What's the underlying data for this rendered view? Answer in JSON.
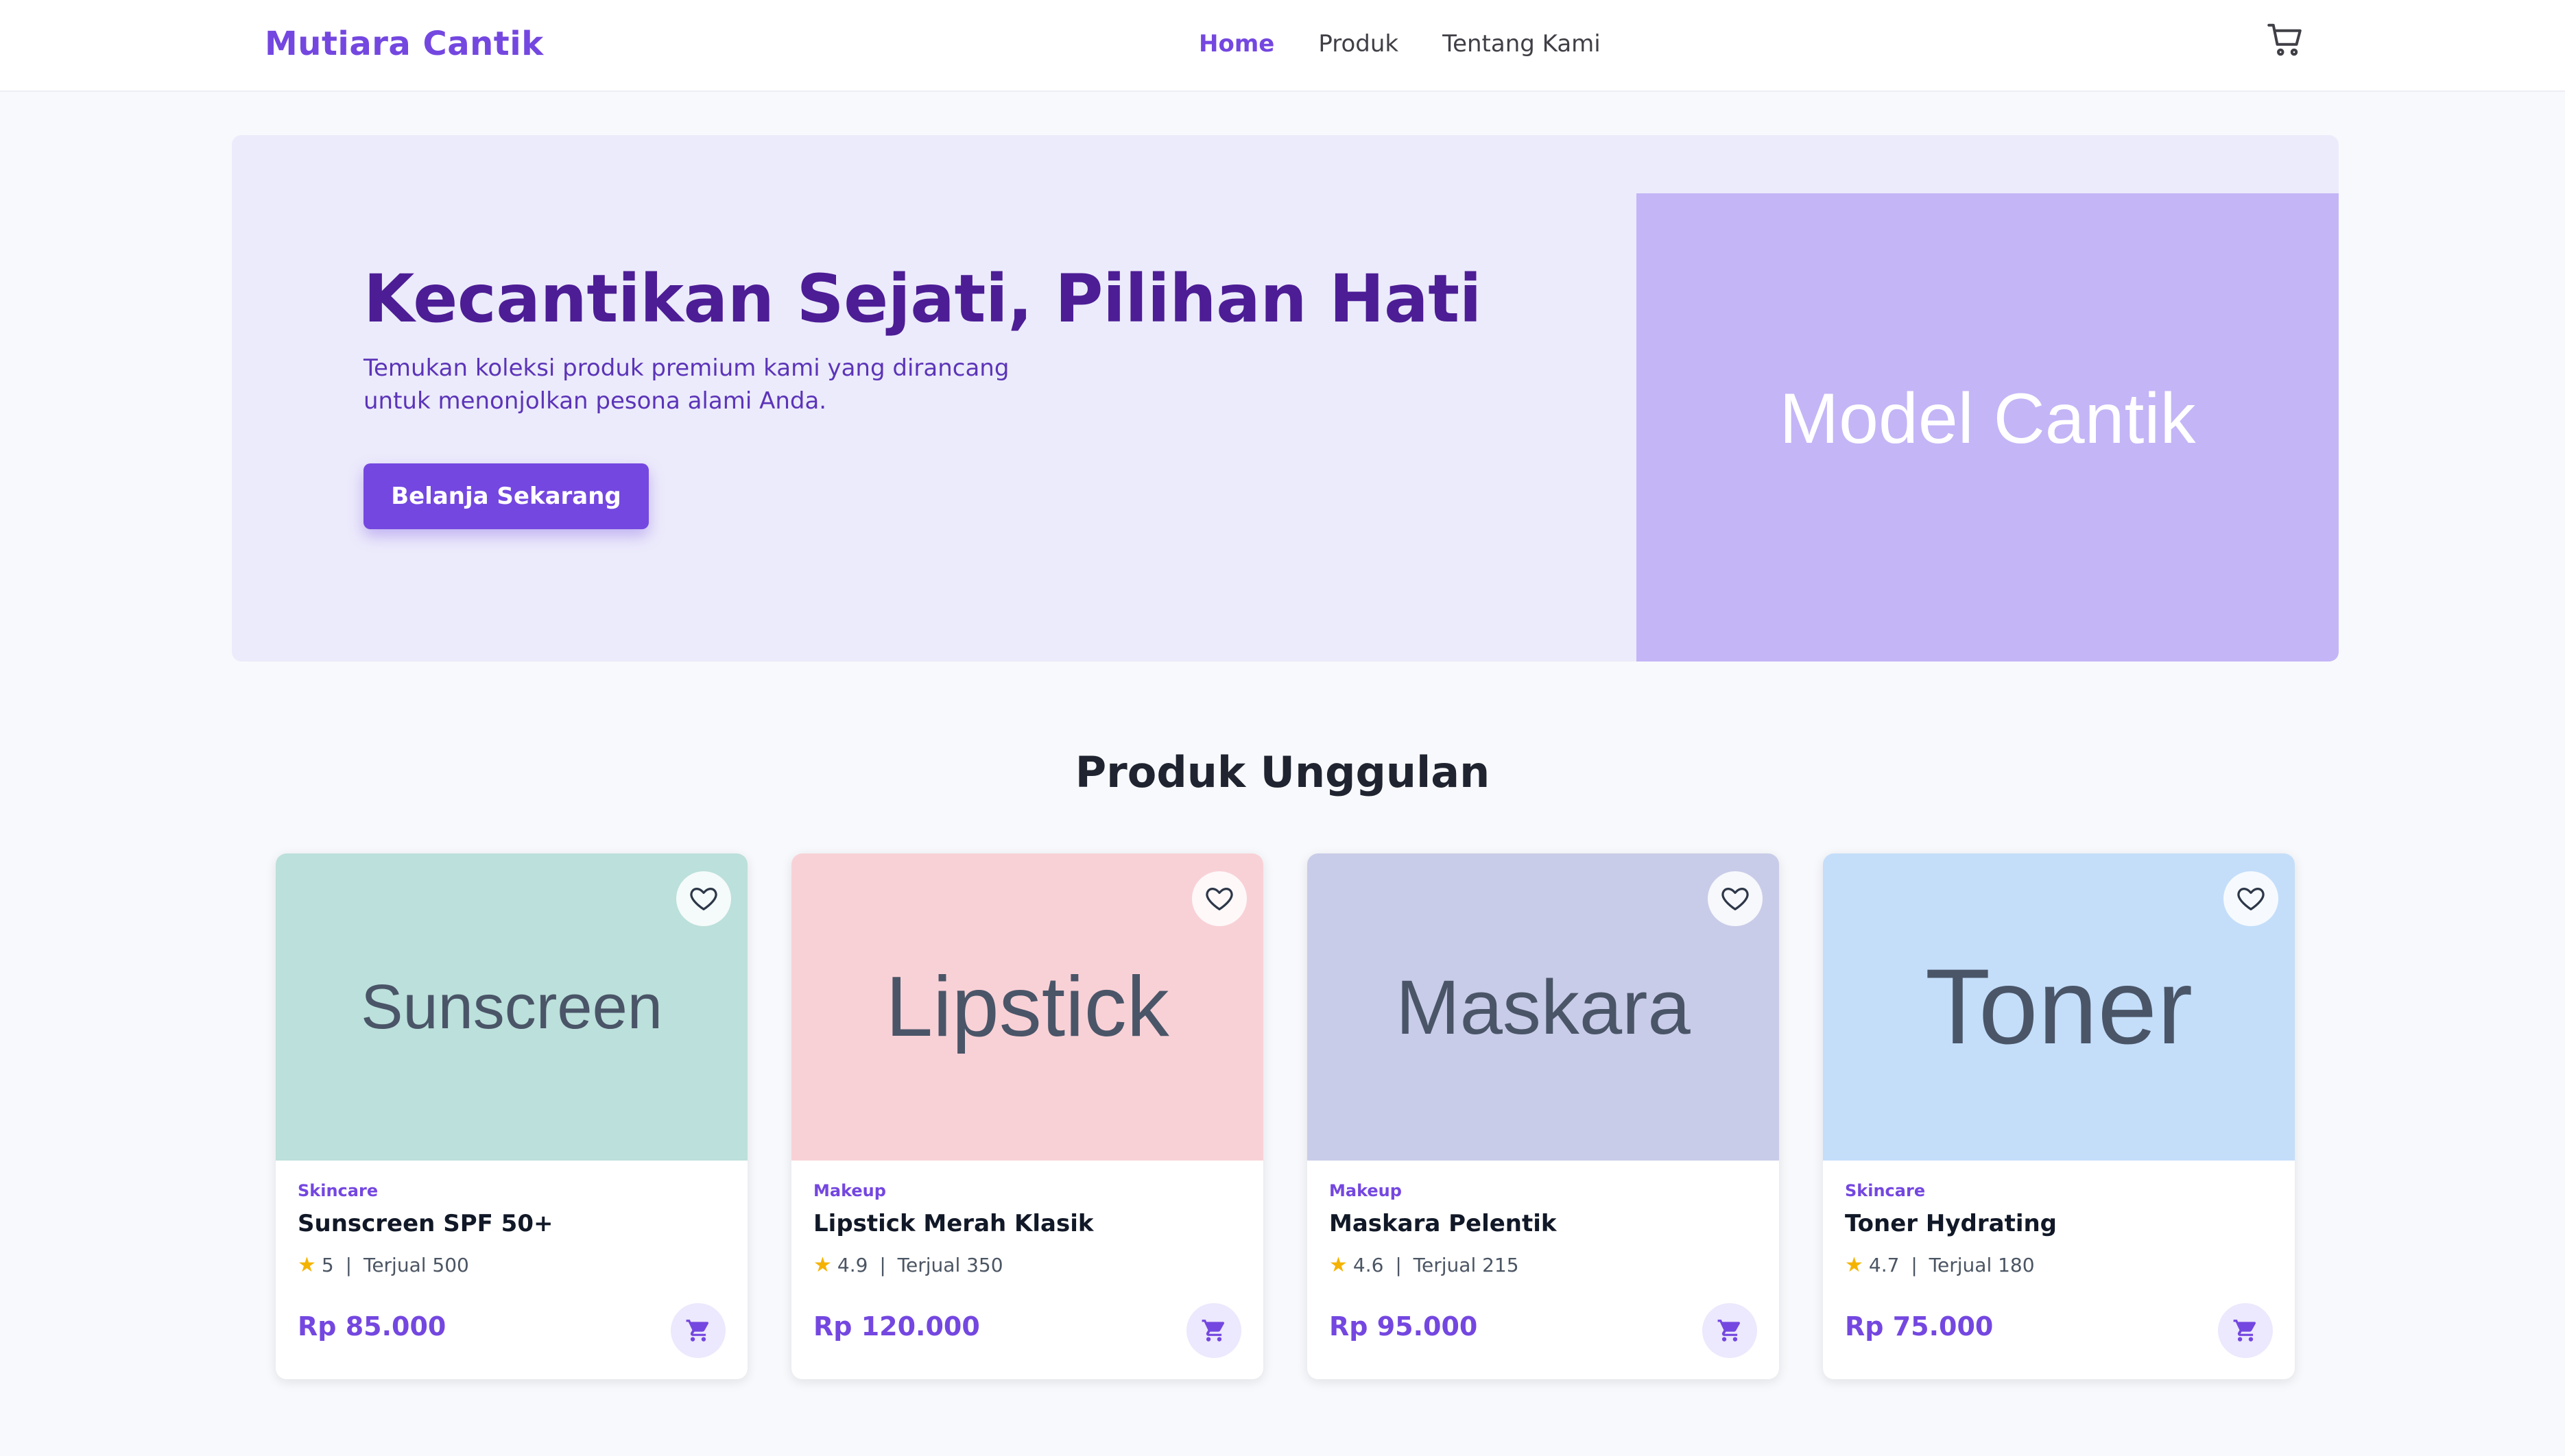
{
  "header": {
    "brand": "Mutiara Cantik",
    "nav": [
      {
        "label": "Home",
        "active": true
      },
      {
        "label": "Produk",
        "active": false
      },
      {
        "label": "Tentang Kami",
        "active": false
      }
    ],
    "cart_icon": "cart-icon"
  },
  "hero": {
    "title": "Kecantikan Sejati, Pilihan Hati",
    "subtitle": "Temukan koleksi produk premium kami yang dirancang untuk menonjolkan pesona alami Anda.",
    "cta_label": "Belanja Sekarang",
    "image_label": "Model Cantik",
    "image_color": "#c4b5f7"
  },
  "section": {
    "title": "Produk Unggulan"
  },
  "products": [
    {
      "image_label": "Sunscreen",
      "image_color": "#bce0db",
      "category": "Skincare",
      "name": "Sunscreen SPF 50+",
      "rating": "5",
      "sold": "Terjual 500",
      "price": "Rp 85.000"
    },
    {
      "image_label": "Lipstick",
      "image_color": "#f8d1d6",
      "category": "Makeup",
      "name": "Lipstick Merah Klasik",
      "rating": "4.9",
      "sold": "Terjual 350",
      "price": "Rp 120.000"
    },
    {
      "image_label": "Maskara",
      "image_color": "#c9cce8",
      "category": "Makeup",
      "name": "Maskara Pelentik",
      "rating": "4.6",
      "sold": "Terjual 215",
      "price": "Rp 95.000"
    },
    {
      "image_label": "Toner",
      "image_color": "#c4defa",
      "category": "Skincare",
      "name": "Toner Hydrating",
      "rating": "4.7",
      "sold": "Terjual 180",
      "price": "Rp 75.000"
    }
  ],
  "icons": {
    "favorite": "heart-icon",
    "add_to_cart": "cart-plus-icon",
    "rating": "star-icon"
  },
  "colors": {
    "accent": "#7447e0",
    "hero_bg": "#ecebfb",
    "hero_title": "#4c1d95"
  }
}
